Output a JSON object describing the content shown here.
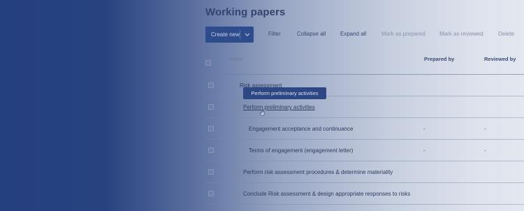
{
  "page": {
    "title": "Working papers"
  },
  "toolbar": {
    "create_label": "Create new",
    "filter_label": "Filter",
    "collapse_label": "Collapse all",
    "expand_label": "Expand all",
    "mark_prepared_label": "Mark as prepared",
    "mark_reviewed_label": "Mark as reviewed",
    "delete_label": "Delete"
  },
  "table": {
    "columns": {
      "name": "Name",
      "prepared": "Prepared by",
      "reviewed": "Reviewed by"
    },
    "rows": [
      {
        "name": "Risk assessment",
        "prepared": "",
        "reviewed": ""
      },
      {
        "name": "Perform preliminary activities",
        "prepared": "",
        "reviewed": ""
      },
      {
        "name": "Engagement acceptance and continuance",
        "prepared": "-",
        "reviewed": "-"
      },
      {
        "name": "Terms of engagement (engagement letter)",
        "prepared": "-",
        "reviewed": "-"
      },
      {
        "name": "Perform risk assessment procedures & determine materiality",
        "prepared": "",
        "reviewed": ""
      },
      {
        "name": "Conclude Risk assessment & design appropriate responses to risks",
        "prepared": "",
        "reviewed": ""
      }
    ]
  },
  "tooltip": {
    "text": "Perform preliminary activities"
  },
  "icons": {
    "folder": "folder-icon",
    "chevron": "chevron-down-icon",
    "cursor": "hand-pointer-icon"
  },
  "colors": {
    "primary": "#2e4c8c",
    "overlay": "#25407f"
  }
}
